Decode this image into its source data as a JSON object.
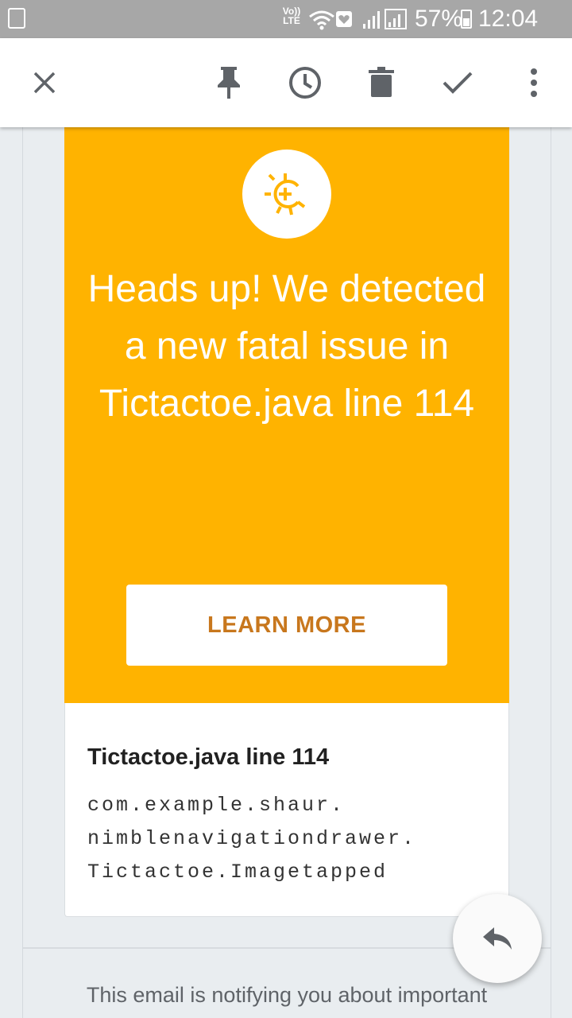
{
  "status_bar": {
    "network_label": "LTE",
    "volte_label": "Vo))",
    "battery_percent": "57%",
    "time": "12:04 am"
  },
  "toolbar": {
    "icons": [
      "close-icon",
      "pin-icon",
      "snooze-clock-icon",
      "delete-icon",
      "done-check-icon",
      "more-vert-icon"
    ]
  },
  "alert": {
    "headline": "Heads up! We detected a new fatal issue in Tictactoe.java line 114",
    "button_label": "LEARN MORE",
    "accent_color": "#ffb300",
    "button_text_color": "#c8771d"
  },
  "detail": {
    "title": "Tictactoe.java line 114",
    "trace": "com.example.shaur.\nnimblenavigationdrawer.\nTictactoe.Imagetapped"
  },
  "footer": {
    "text": "This email is notifying you about important"
  }
}
